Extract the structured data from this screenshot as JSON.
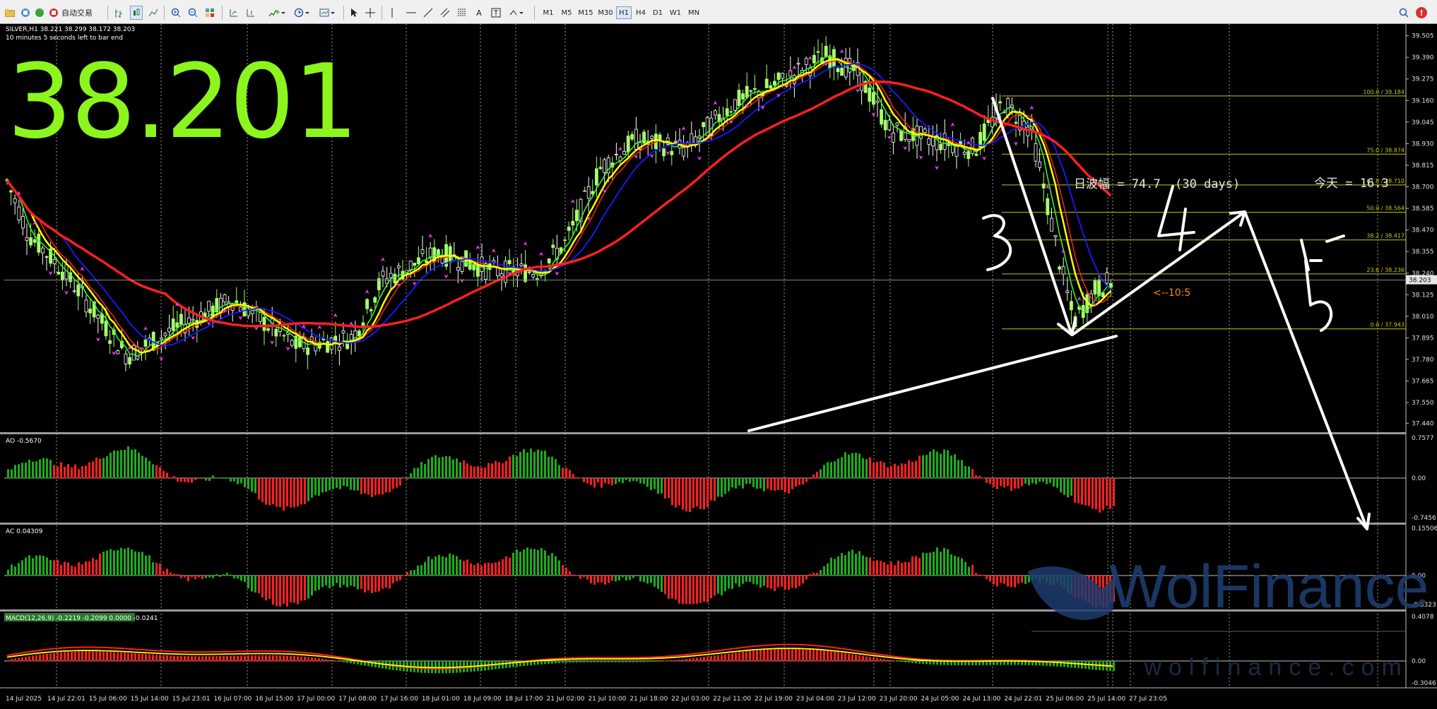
{
  "toolbar": {
    "auto_trading_label": "自动交易",
    "timeframes": [
      "M1",
      "M5",
      "M15",
      "M30",
      "H1",
      "H4",
      "D1",
      "W1",
      "MN"
    ],
    "active_timeframe": "H1",
    "alert_badge": "!"
  },
  "chart": {
    "symbol_header": "SILVER,H1  38.221 38.299 38.172 38.203",
    "bar_timer": "10 minutes 5 seconds left to bar end",
    "big_price": "38.201",
    "big_price_color": "#8cf51e",
    "current_price_tag": "38.203",
    "annotation_volatility": "日波幅 = 74.7  (30 days)",
    "annotation_today": "今天 = 16.3",
    "annotation_arrow": "<--10:5",
    "handwritten": [
      "3",
      "4",
      "5"
    ],
    "watermark": "WolFinance",
    "watermark_url": ".wolfinance.com",
    "price_axis": [
      "39.505",
      "39.390",
      "39.275",
      "39.160",
      "39.045",
      "38.930",
      "38.815",
      "38.700",
      "38.585",
      "38.470",
      "38.355",
      "38.240",
      "38.125",
      "38.010",
      "37.895",
      "37.780",
      "37.665",
      "37.550",
      "37.440"
    ],
    "fib_levels": [
      {
        "label": "100.0 / 39.184",
        "value": 39.184
      },
      {
        "label": "75.0 / 38.874",
        "value": 38.874
      },
      {
        "label": "61.8 / 38.710",
        "value": 38.71
      },
      {
        "label": "50.0 / 38.564",
        "value": 38.564
      },
      {
        "label": "38.2 / 38.417",
        "value": 38.417
      },
      {
        "label": "23.6 / 38.236",
        "value": 38.236
      },
      {
        "label": "0.0 / 37.943",
        "value": 37.943
      }
    ],
    "time_axis": [
      "14 Jul 2025",
      "14 Jul 22:01",
      "15 Jul 06:00",
      "15 Jul 14:00",
      "15 Jul 23:01",
      "16 Jul 07:00",
      "16 Jul 15:00",
      "17 Jul 00:00",
      "17 Jul 08:00",
      "17 Jul 16:00",
      "18 Jul 01:00",
      "18 Jul 09:00",
      "18 Jul 17:00",
      "21 Jul 02:00",
      "21 Jul 10:00",
      "21 Jul 18:00",
      "22 Jul 03:00",
      "22 Jul 11:00",
      "22 Jul 19:00",
      "23 Jul 04:00",
      "23 Jul 12:00",
      "23 Jul 20:00",
      "24 Jul 05:00",
      "24 Jul 13:00",
      "24 Jul 22:01",
      "25 Jul 06:00",
      "25 Jul 14:00",
      "27 Jul 23:05"
    ]
  },
  "indicators": {
    "ao": {
      "label": "AO -0.5670",
      "max": "0.7577",
      "zero": "0.00",
      "min": "-0.7456"
    },
    "ac": {
      "label": "AC 0.04309",
      "max": "0.15506",
      "zero": "0.00",
      "min": "-0.3323"
    },
    "macd": {
      "label": "MACD(12,26,9) -0.2219 -0.2099 0.0000 -0.0241",
      "max": "0.4078",
      "zero": "0.00",
      "min": "-0.3046"
    }
  },
  "colors": {
    "bull": "#a8ff6a",
    "ma_red": "#ff2020",
    "ma_yellow": "#ffff00",
    "ma_blue": "#1a1aff",
    "ma_green": "#30ff30",
    "fractal": "#ff3cff",
    "fib": "#c8c800"
  }
}
